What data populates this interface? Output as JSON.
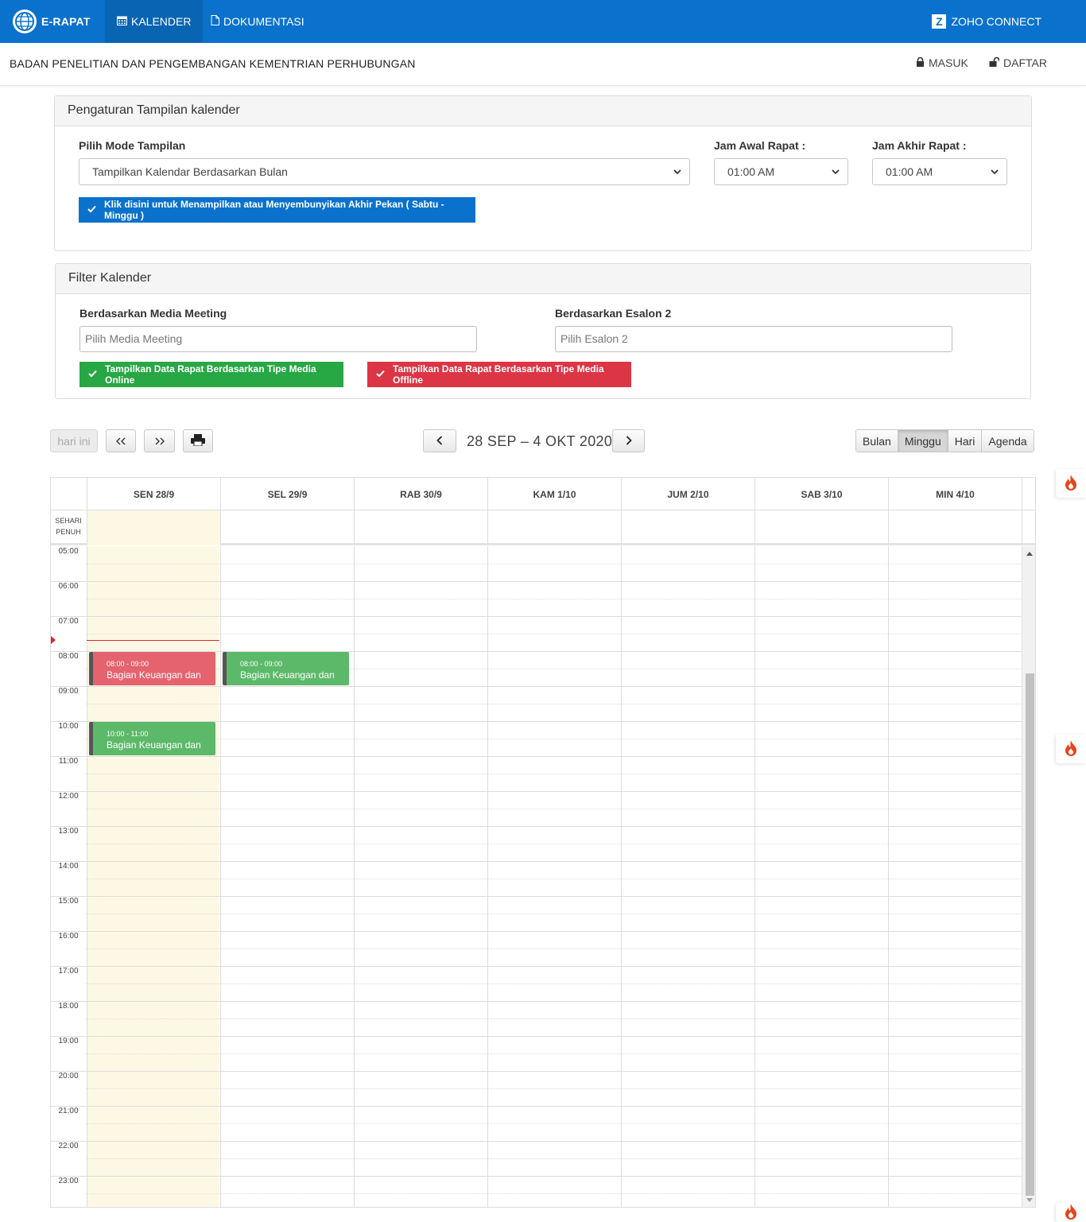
{
  "nav": {
    "brand": "E-RAPAT",
    "tabs": [
      {
        "label": "KALENDER",
        "icon": "calendar-icon",
        "active": true
      },
      {
        "label": "DOKUMENTASI",
        "icon": "document-icon",
        "active": false
      }
    ],
    "zoho": {
      "logo_letter": "Z",
      "label": "ZOHO CONNECT"
    }
  },
  "subheader": {
    "org": "BADAN PENELITIAN DAN PENGEMBANGAN KEMENTRIAN PERHUBUNGAN",
    "login": "MASUK",
    "register": "DAFTAR"
  },
  "settings": {
    "title": "Pengaturan Tampilan kalender",
    "mode_label": "Pilih Mode Tampilan",
    "mode_value": "Tampilkan Kalendar Berdasarkan Bulan",
    "start_label": "Jam Awal Rapat :",
    "start_value": "01:00 AM",
    "end_label": "Jam Akhir Rapat :",
    "end_value": "01:00 AM",
    "weekend_button": "Klik disini untuk Menampilkan atau Menyembunyikan Akhir Pekan ( Sabtu - Minggu )"
  },
  "filter": {
    "title": "Filter Kalender",
    "media_label": "Berdasarkan Media Meeting",
    "media_placeholder": "Pilih Media Meeting",
    "esalon_label": "Berdasarkan Esalon 2",
    "esalon_placeholder": "Pilih Esalon 2",
    "online_button": "Tampilkan Data Rapat Berdasarkan Tipe Media Online",
    "offline_button": "Tampilkan Data Rapat Berdasarkan Tipe Media Offline"
  },
  "toolbar": {
    "today": "hari ini",
    "prev_year": "«",
    "next_year": "»",
    "range": "28 SEP – 4 OKT 2020",
    "views": [
      "Bulan",
      "Minggu",
      "Hari",
      "Agenda"
    ],
    "active_view": "Minggu"
  },
  "calendar": {
    "allday_label_1": "SEHARI",
    "allday_label_2": "PENUH",
    "days": [
      "SEN 28/9",
      "SEL 29/9",
      "RAB 30/9",
      "KAM 1/10",
      "JUM 2/10",
      "SAB 3/10",
      "MIN 4/10"
    ],
    "today_index": 0,
    "hours": [
      "05:00",
      "06:00",
      "07:00",
      "08:00",
      "09:00",
      "10:00",
      "11:00",
      "12:00",
      "13:00",
      "14:00",
      "15:00",
      "16:00",
      "17:00",
      "18:00",
      "19:00",
      "20:00",
      "21:00",
      "22:00",
      "23:00"
    ],
    "events": [
      {
        "day": 0,
        "time": "08:00 - 09:00",
        "title": "Bagian Keuangan dan",
        "color": "#e4636f"
      },
      {
        "day": 1,
        "time": "08:00 - 09:00",
        "title": "Bagian Keuangan dan",
        "color": "#5cb96a"
      },
      {
        "day": 0,
        "time": "10:00 - 11:00",
        "title": "Bagian Keuangan dan",
        "color": "#5cb96a"
      }
    ]
  },
  "colors": {
    "nav": "#0a72cc",
    "primary": "#0a72cc",
    "success": "#28a745",
    "danger": "#dc3545",
    "today": "#fcf8e3"
  }
}
